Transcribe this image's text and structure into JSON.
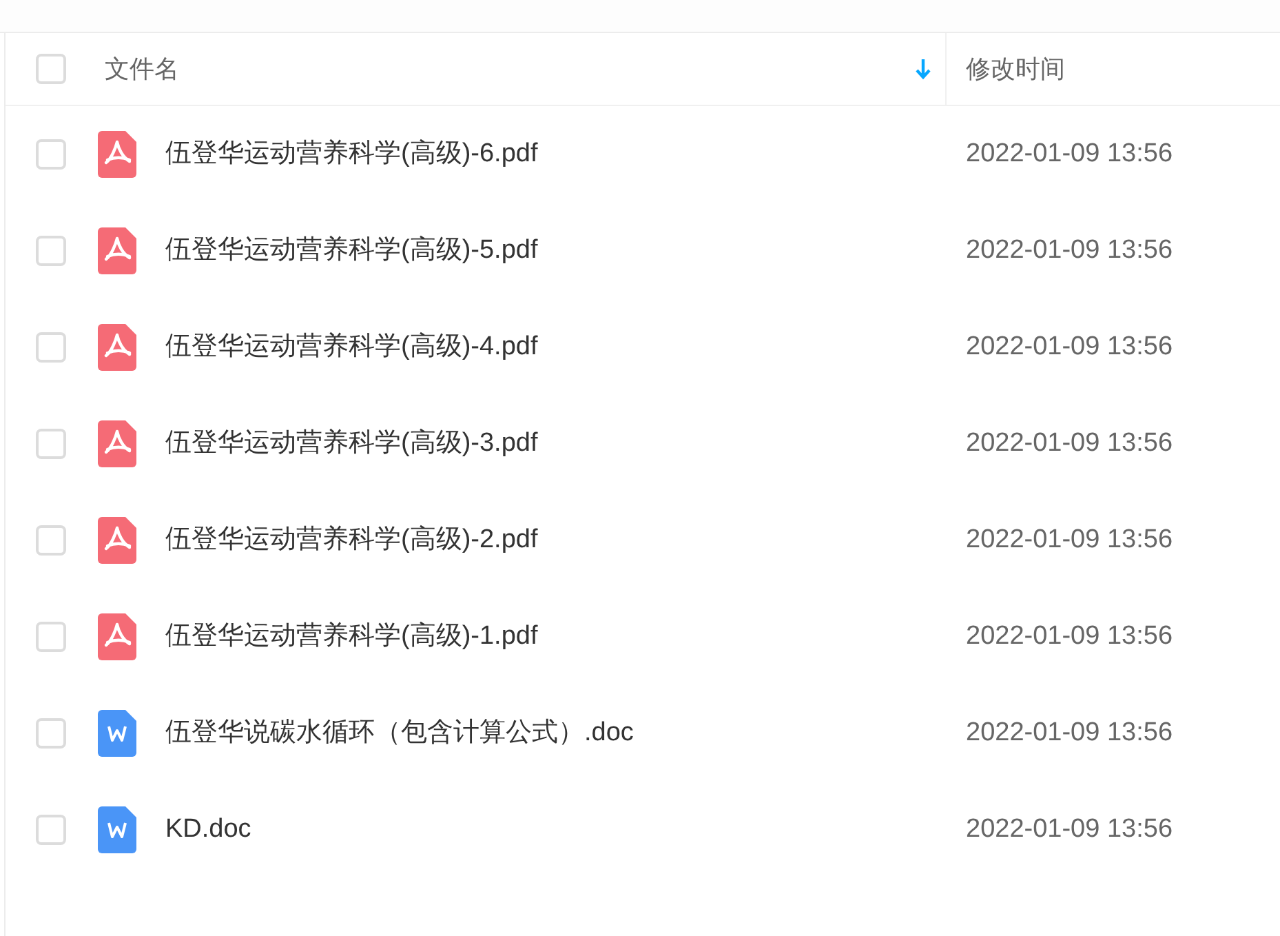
{
  "table": {
    "columns": [
      {
        "label": "文件名",
        "sorted": true
      },
      {
        "label": "修改时间",
        "sorted": false
      }
    ],
    "header_checked": false,
    "rows": [
      {
        "kind": "pdf",
        "name": "伍登华运动营养科学(高级)-6.pdf",
        "modified": "2022-01-09 13:56",
        "checked": false
      },
      {
        "kind": "pdf",
        "name": "伍登华运动营养科学(高级)-5.pdf",
        "modified": "2022-01-09 13:56",
        "checked": false
      },
      {
        "kind": "pdf",
        "name": "伍登华运动营养科学(高级)-4.pdf",
        "modified": "2022-01-09 13:56",
        "checked": false
      },
      {
        "kind": "pdf",
        "name": "伍登华运动营养科学(高级)-3.pdf",
        "modified": "2022-01-09 13:56",
        "checked": false
      },
      {
        "kind": "pdf",
        "name": "伍登华运动营养科学(高级)-2.pdf",
        "modified": "2022-01-09 13:56",
        "checked": false
      },
      {
        "kind": "pdf",
        "name": "伍登华运动营养科学(高级)-1.pdf",
        "modified": "2022-01-09 13:56",
        "checked": false
      },
      {
        "kind": "doc",
        "name": "伍登华说碳水循环（包含计算公式）.doc",
        "modified": "2022-01-09 13:56",
        "checked": false
      },
      {
        "kind": "doc",
        "name": "KD.doc",
        "modified": "2022-01-09 13:56",
        "checked": false
      }
    ]
  }
}
